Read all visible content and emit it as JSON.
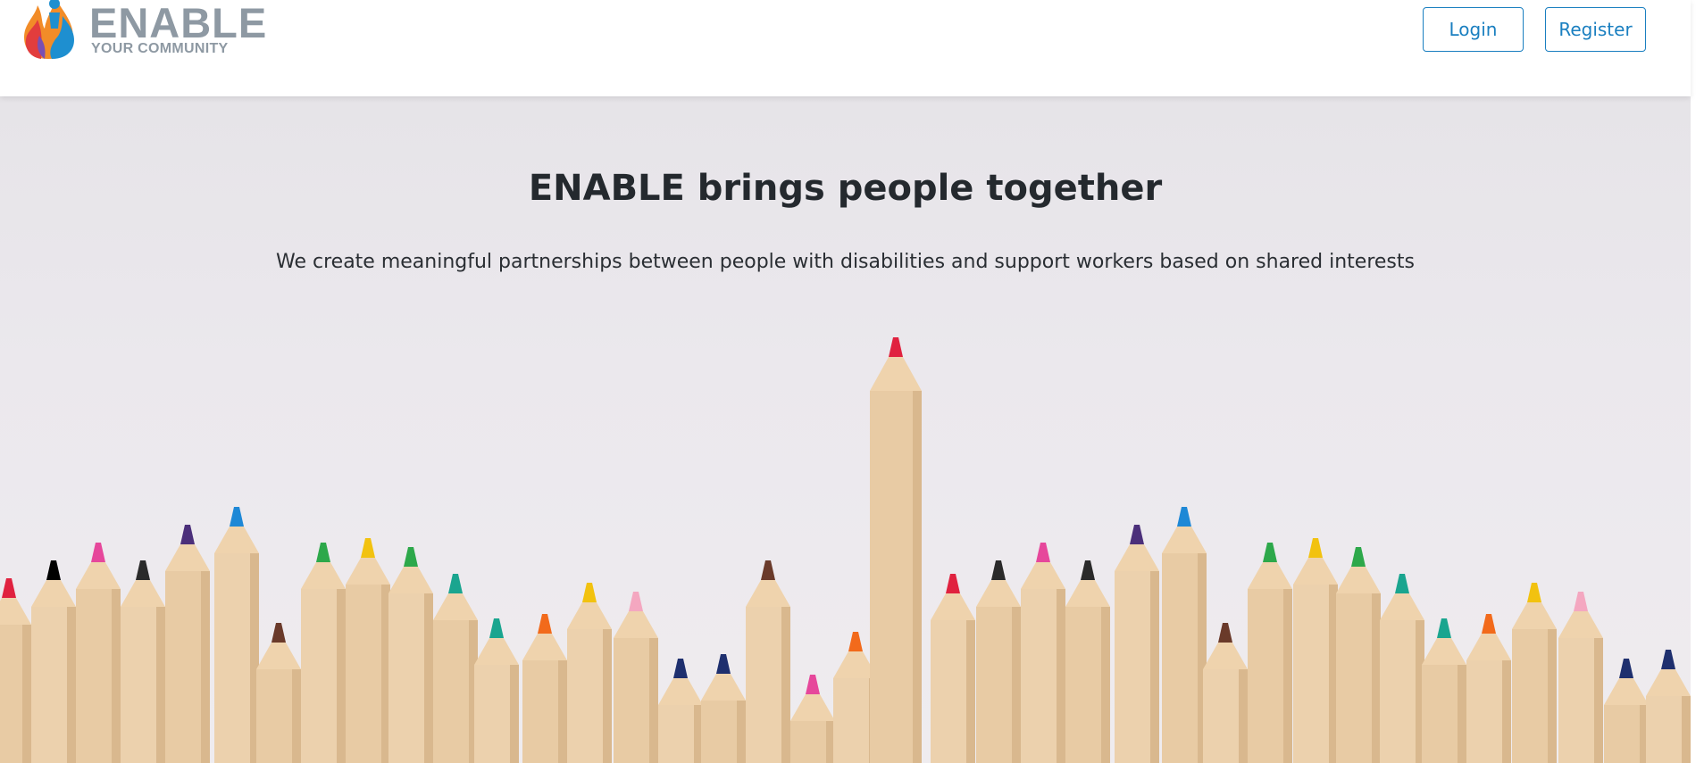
{
  "header": {
    "logo": {
      "word": "ENABLE",
      "tagline": "YOUR COMMUNITY",
      "icon": "flame-person-logo-icon",
      "colors": {
        "text": "#8e99a3",
        "blue": "#1e8fd0",
        "orange": "#f28c28",
        "red": "#e23d3d",
        "purple": "#7a4fb3"
      }
    },
    "login_label": "Login",
    "register_label": "Register",
    "accent_color": "#1a7fc0"
  },
  "hero": {
    "title": "ENABLE brings people together",
    "subtitle": "We create meaningful partnerships between people with disabilities and support workers based on shared interests",
    "background_image": "colored-pencils-image",
    "pencil_tip_colors": [
      "#e0223f",
      "#e6479b",
      "#2a2a2a",
      "#4b2f7a",
      "#1e88d6",
      "#2da84a",
      "#f2c20f",
      "#1aa58f",
      "#f26a1b",
      "#5a2e22",
      "#f4a7c0",
      "#1e2f6e",
      "#6a3a2a"
    ]
  }
}
